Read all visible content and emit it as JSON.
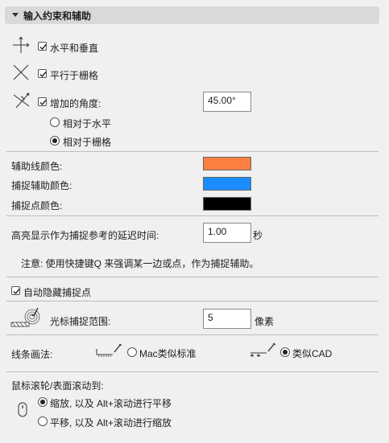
{
  "section": {
    "title": "输入约束和辅助"
  },
  "constraints": {
    "horizontal_vertical": {
      "label": "水平和垂直",
      "checked": true
    },
    "parallel_grid": {
      "label": "平行于栅格",
      "checked": true
    },
    "angle_increment": {
      "label": "增加的角度:",
      "checked": true,
      "value": "45.00°"
    },
    "relative_horizontal": {
      "label": "相对于水平",
      "selected": false
    },
    "relative_grid": {
      "label": "相对于栅格",
      "selected": true
    }
  },
  "colors": {
    "guide_line": {
      "label": "辅助线颜色:",
      "color": "#ff7f40"
    },
    "snap_guide": {
      "label": "捕捉辅助颜色:",
      "color": "#1a8cff"
    },
    "snap_point": {
      "label": "捕捉点颜色:",
      "color": "#000000"
    }
  },
  "highlight_delay": {
    "label": "高亮显示作为捕捉参考的延迟时间:",
    "value": "1.00",
    "unit": "秒"
  },
  "note": "注意: 使用快捷键Q 来强调某一边或点，作为捕捉辅助。",
  "auto_hide": {
    "label": "自动隐藏捕捉点",
    "checked": true
  },
  "cursor_snap": {
    "label": "光标捕捉范围:",
    "value": "5",
    "unit": "像素"
  },
  "line_drawing": {
    "label": "线条画法:",
    "mac_like": {
      "label": "Mac类似标准",
      "selected": false
    },
    "cad_like": {
      "label": "类似CAD",
      "selected": true
    }
  },
  "scroll": {
    "label": "鼠标滚轮/表面滚动到:",
    "zoom_option": {
      "label": "缩放, 以及 Alt+滚动进行平移",
      "selected": true
    },
    "pan_option": {
      "label": "平移, 以及 Alt+滚动进行缩放",
      "selected": false
    }
  }
}
